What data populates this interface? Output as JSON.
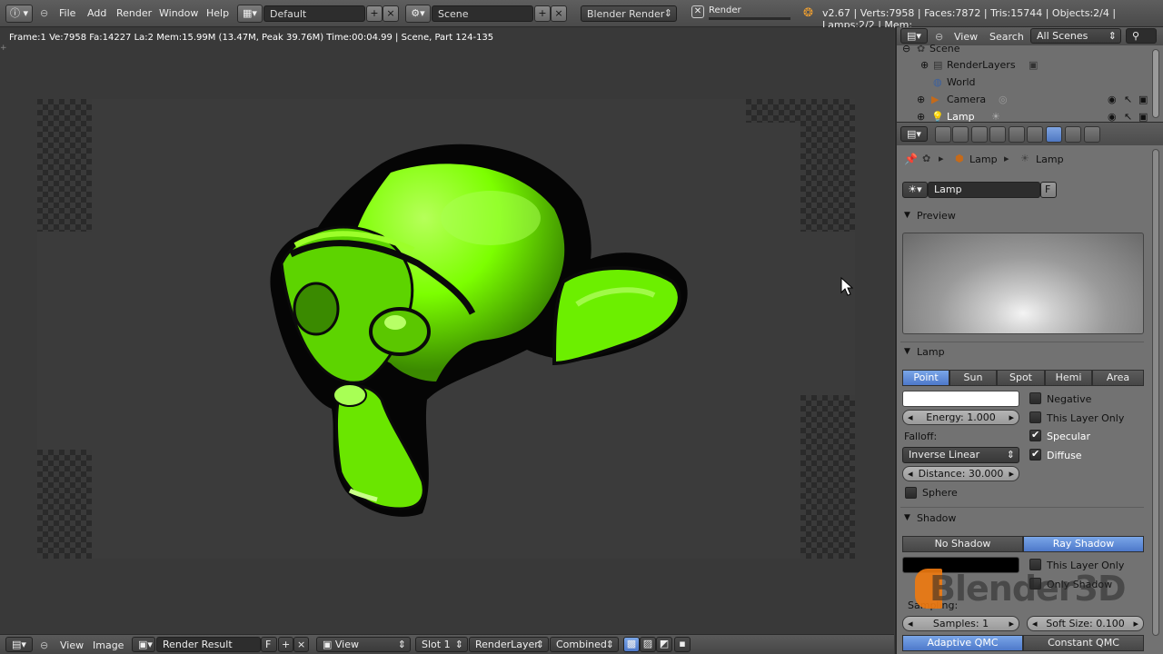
{
  "header": {
    "menus": [
      "File",
      "Add",
      "Render",
      "Window",
      "Help"
    ],
    "screen_layout": "Default",
    "scene": "Scene",
    "engine": "Blender Render",
    "progress_label": "Render",
    "stats": "v2.67 | Verts:7958 | Faces:7872 | Tris:15744 | Objects:2/4 | Lamps:2/2 | Mem:"
  },
  "editor": {
    "status_line": "Frame:1 Ve:7958 Fa:14227 La:2 Mem:15.99M (13.47M, Peak 39.76M) Time:00:04.99 | Scene, Part 124-135"
  },
  "image_header": {
    "view": "View",
    "image": "Image",
    "image_name": "Render Result",
    "fake_user": "F",
    "display_view": "View",
    "slot": "Slot 1",
    "layer": "RenderLayer",
    "pass": "Combined"
  },
  "outliner": {
    "view": "View",
    "search": "Search",
    "filter": "All Scenes",
    "items": [
      {
        "label": "Scene"
      },
      {
        "label": "RenderLayers"
      },
      {
        "label": "World"
      },
      {
        "label": "Camera"
      },
      {
        "label": "Lamp"
      }
    ]
  },
  "properties": {
    "breadcrumb": [
      "Lamp",
      "Lamp"
    ],
    "datablock_name": "Lamp",
    "fake_user": "F",
    "preview_section": "Preview",
    "lamp_section": "Lamp",
    "lamp_types": [
      "Point",
      "Sun",
      "Spot",
      "Hemi",
      "Area"
    ],
    "active_lamp_type": "Point",
    "energy": "Energy: 1.000",
    "falloff_label": "Falloff:",
    "falloff_value": "Inverse Linear",
    "distance": "Distance: 30.000",
    "sphere": "Sphere",
    "negative": "Negative",
    "this_layer_only": "This Layer Only",
    "specular": "Specular",
    "diffuse": "Diffuse",
    "shadow_section": "Shadow",
    "shadow_modes": [
      "No Shadow",
      "Ray Shadow"
    ],
    "active_shadow": "Ray Shadow",
    "shadow_layer_only": "This Layer Only",
    "only_shadow": "Only Shadow",
    "sampling_label": "Sampling:",
    "samples": "Samples: 1",
    "soft_size": "Soft Size: 0.100",
    "qmc_modes": [
      "Adaptive QMC",
      "Constant QMC"
    ],
    "active_qmc": "Adaptive QMC",
    "watermark": "Blender3D"
  },
  "colors": {
    "accent": "#5680c2",
    "monkey_green": "#7cff00",
    "lamp_color": "#ffffff",
    "shadow_color": "#000000"
  }
}
